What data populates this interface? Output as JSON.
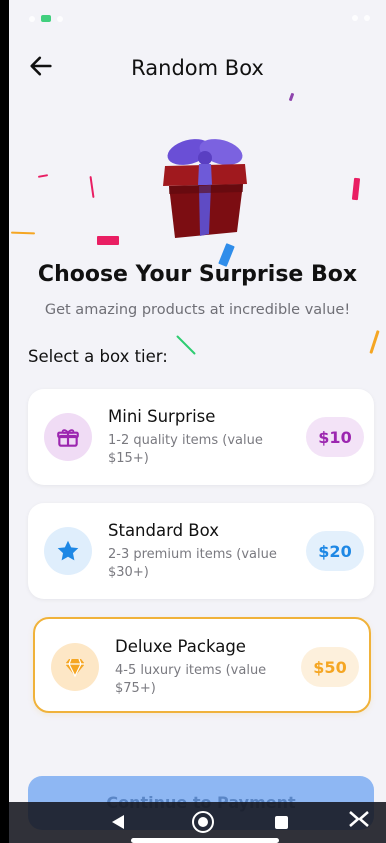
{
  "header": {
    "title": "Random Box"
  },
  "hero": {
    "heading": "Choose Your Surprise Box",
    "subheading": "Get amazing products at incredible value!"
  },
  "section_label": "Select a box tier:",
  "tiers": [
    {
      "name": "Mini Surprise",
      "description": "1-2 quality items (value $15+)",
      "price": "$10",
      "icon": "gift-box-icon",
      "accent": "#9c27b0",
      "pill_bg": "#f3e3f7"
    },
    {
      "name": "Standard Box",
      "description": "2-3 premium items (value $30+)",
      "price": "$20",
      "icon": "star-icon",
      "accent": "#1e88e5",
      "pill_bg": "#e3f0fc"
    },
    {
      "name": "Deluxe Package",
      "description": "4-5 luxury items (value $75+)",
      "price": "$50",
      "icon": "diamond-icon",
      "accent": "#f5a623",
      "pill_bg": "#fdf0dc",
      "selected": true
    }
  ],
  "cta": {
    "label": "Continue to Payment"
  },
  "colors": {
    "background": "#f3f3f8",
    "selected_border": "#f0b23a",
    "cta": "#8eb7f3"
  }
}
